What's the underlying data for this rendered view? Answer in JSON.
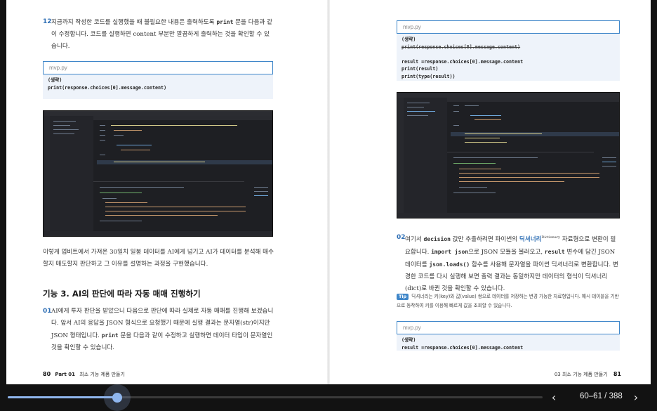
{
  "left_page": {
    "step12": {
      "number": "12",
      "text_before": "지금까지 작성한 코드를 실행했을 때 불필요한 내용은 출력하도록 ",
      "keyword": "print",
      "text_after": " 문을 다음과 같이 수정합니다. 코드를 실행하면 content 부분만 깔끔하게 출력하는 것을 확인할 수 있습니다."
    },
    "code1": {
      "filename": "mvp.py",
      "lines": [
        "(생략)",
        "",
        "print(response.choices[0].message.content)"
      ]
    },
    "paragraph": "이렇게 업비트에서 가져온 30일치 일봉 데이터를 AI에게 넘기고 AI가 데이터를 분석해 매수할지 매도할지 판단하고 그 이유를 설명하는 과정을 구현했습니다.",
    "section_heading": "기능 3. AI의 판단에 따라 자동 매매 진행하기",
    "step01": {
      "number": "01",
      "text_before": "AI에게 투자 판단을 받았으니 다음으로 판단에 따라 실제로 자동 매매를 진행해 보겠습니다. 앞서 AI의 응답을 JSON 형식으로 요청했기 때문에 실행 결과는 문자열(str)이지만 JSON 형태입니다. ",
      "keyword": "print",
      "text_after": " 문을 다음과 같이 수정하고 실행하면 데이터 타입이 문자열인 것을 확인할 수 있습니다."
    },
    "footer": {
      "page_number": "80",
      "part": "Part 01",
      "title": "최소 기능 제품 만들기"
    }
  },
  "right_page": {
    "code2": {
      "filename": "mvp.py",
      "lines": [
        "(생략)",
        "print(response.choices[0].message.content)",
        "",
        "result =response.choices[0].message.content",
        "print(result)",
        "print(type(result))"
      ]
    },
    "step02": {
      "number": "02",
      "t1": "여기서 ",
      "k1": "decision",
      "t2": " 값만 추출하려면 파이썬의 ",
      "k2": "딕셔너리",
      "k2_sup": "Dictionary",
      "t3": " 자료형으로 변환이 필요합니다. ",
      "k3": "import json",
      "t4": "으로 JSON 모듈을 불러오고, ",
      "k4": "result",
      "t5": " 변수에 담긴 JSON 데이터를 ",
      "k5": "json.loads()",
      "t6": " 함수를 사용해 문자열을 파이썬 딕셔너리로 변환합니다. 변경한 코드를 다시 실행해 보면 출력 결과는 동일하지만 데이터의 형식이 딕셔너리(dict)로 바뀐 것을 확인할 수 있습니다."
    },
    "tip": {
      "badge": "Tip",
      "text": "딕셔너리는 키(key)와 값(value) 쌍으로 데이터를 저장하는 변경 가능한 자료형입니다. 해시 테이블을 기반으로 동작하여 키를 이용해 빠르게 값을 조회할 수 있습니다."
    },
    "code3": {
      "filename": "mvp.py",
      "lines": [
        "(생략)",
        "result =response.choices[0].message.content"
      ]
    },
    "footer": {
      "section": "03 최소 기능 제품 만들기",
      "page_number": "81"
    }
  },
  "viewer": {
    "page_indicator": "60–61 / 388",
    "progress": 0.205,
    "prev_icon": "chevron-left-icon",
    "next_icon": "chevron-right-icon",
    "accent_color": "#8fb6ee",
    "link_color": "#3e86c9"
  }
}
